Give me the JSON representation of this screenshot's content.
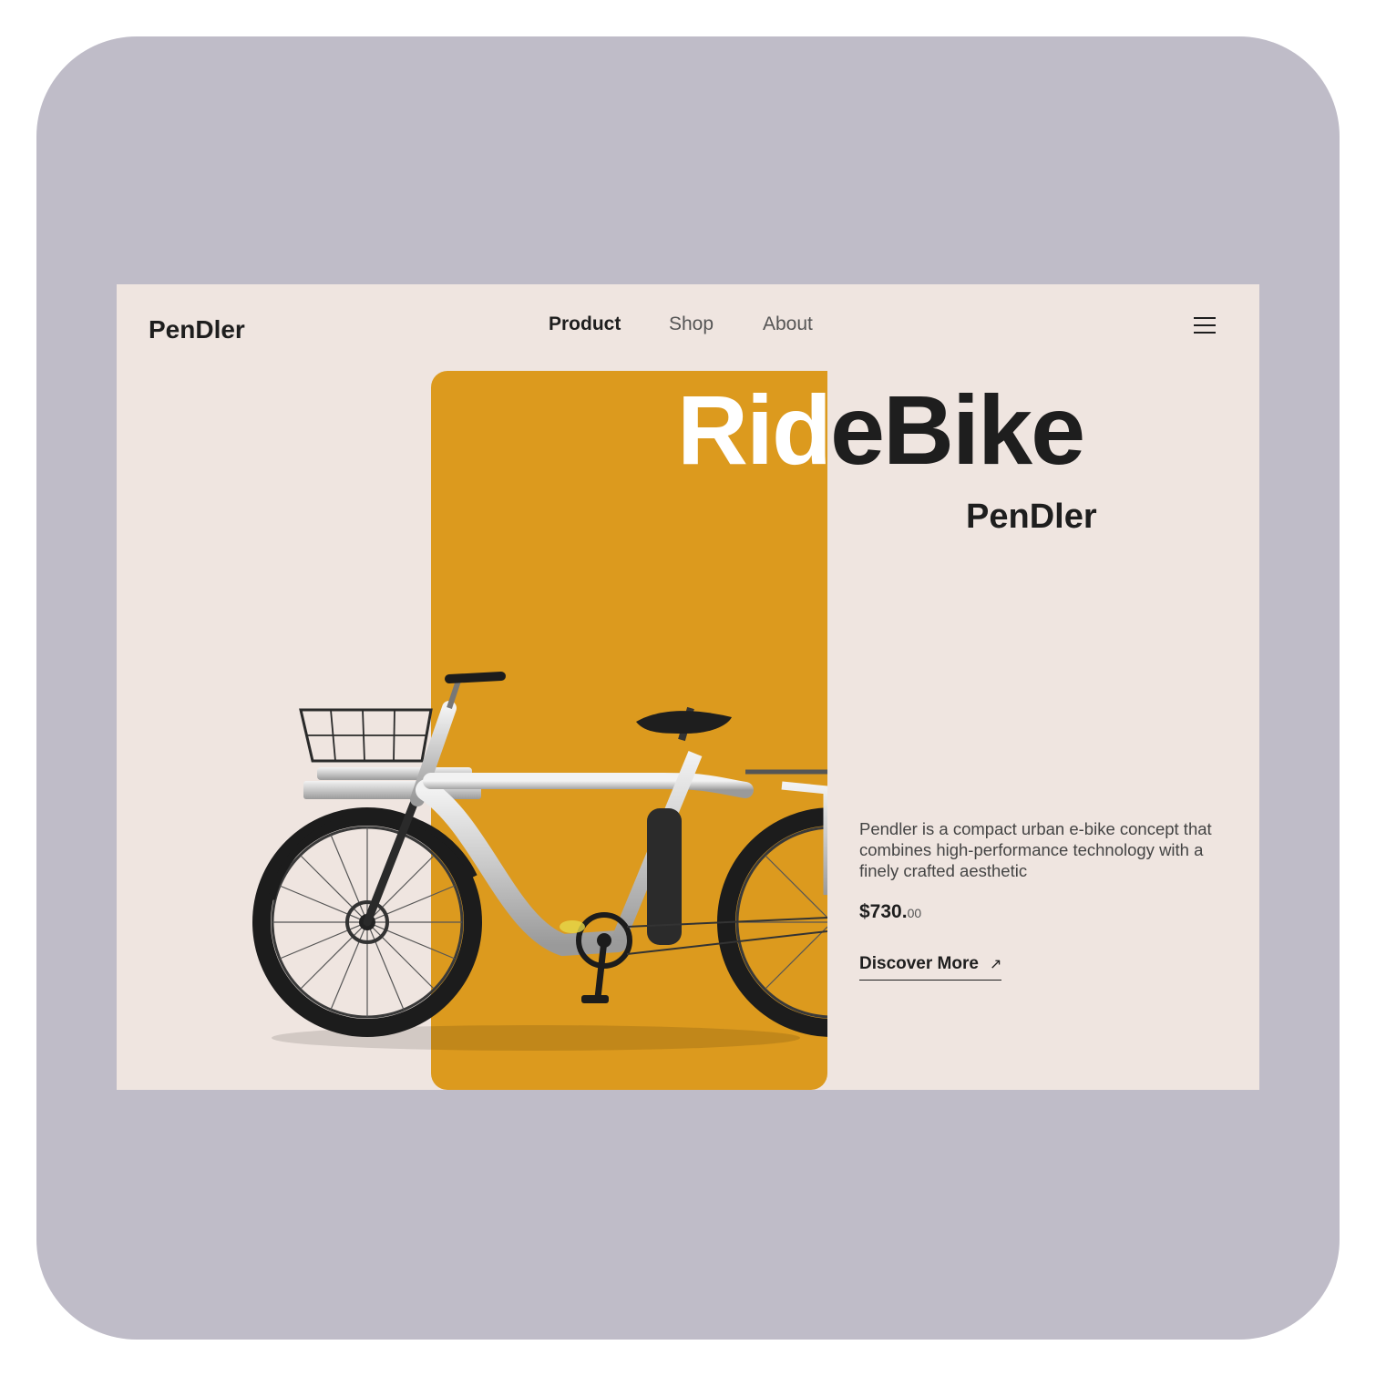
{
  "header": {
    "logo": "PenDler",
    "nav": [
      {
        "label": "Product",
        "active": true
      },
      {
        "label": "Shop",
        "active": false
      },
      {
        "label": "About",
        "active": false
      }
    ],
    "menu_icon": "hamburger-menu-icon"
  },
  "hero": {
    "title_part1": "Rid",
    "title_part2": "eBike",
    "subtitle": "PenDler",
    "description": "Pendler is a compact urban e-bike concept that combines high-performance technology with a finely crafted aesthetic",
    "price_main": "$730.",
    "price_cents": "00",
    "cta_label": "Discover More",
    "cta_icon": "arrow-up-right-icon",
    "cta_arrow": "↗"
  },
  "colors": {
    "frame_background": "#bfbcc8",
    "page_background": "#efe5e0",
    "accent_orange": "#dc9a1e",
    "text_dark": "#1e1e1e"
  }
}
